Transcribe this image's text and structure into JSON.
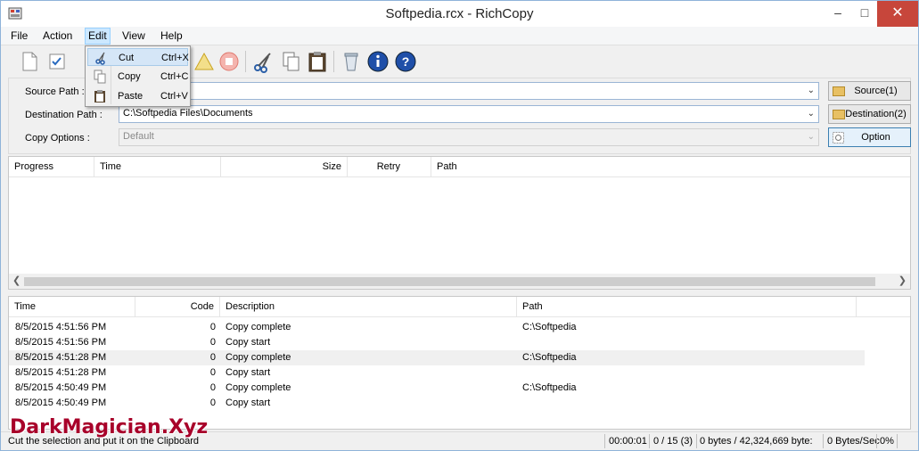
{
  "window": {
    "title": "Softpedia.rcx - RichCopy"
  },
  "menu": [
    "File",
    "Action",
    "Edit",
    "View",
    "Help"
  ],
  "paths": {
    "source_label": "Source Path :",
    "source_value": "",
    "dest_label": "Destination Path :",
    "dest_value": "C:\\Softpedia Files\\Documents",
    "options_label": "Copy Options :",
    "options_value": "Default",
    "source_button": "Source(1)",
    "dest_button": "Destination(2)",
    "option_button": "Option"
  },
  "progress_headers": [
    "Progress",
    "Time",
    "Size",
    "Retry",
    "Path"
  ],
  "log_headers": [
    "Time",
    "Code",
    "Description",
    "Path"
  ],
  "log_rows": [
    {
      "time": "8/5/2015 4:51:56 PM",
      "code": "0",
      "desc": "Copy complete",
      "path": "C:\\Softpedia"
    },
    {
      "time": "8/5/2015 4:51:56 PM",
      "code": "0",
      "desc": "Copy start",
      "path": ""
    },
    {
      "time": "8/5/2015 4:51:28 PM",
      "code": "0",
      "desc": "Copy complete",
      "path": "C:\\Softpedia"
    },
    {
      "time": "8/5/2015 4:51:28 PM",
      "code": "0",
      "desc": "Copy start",
      "path": ""
    },
    {
      "time": "8/5/2015 4:50:49 PM",
      "code": "0",
      "desc": "Copy complete",
      "path": "C:\\Softpedia"
    },
    {
      "time": "8/5/2015 4:50:49 PM",
      "code": "0",
      "desc": "Copy start",
      "path": ""
    }
  ],
  "edit_menu": [
    {
      "label": "Cut",
      "shortcut": "Ctrl+X"
    },
    {
      "label": "Copy",
      "shortcut": "Ctrl+C"
    },
    {
      "label": "Paste",
      "shortcut": "Ctrl+V"
    }
  ],
  "status": {
    "message": "Cut the selection and put it on the Clipboard",
    "elapsed": "00:00:01",
    "files": "0 / 15 (3)",
    "bytes": "0 bytes / 42,324,669 byte:",
    "rate": "0 Bytes/Sec",
    "percent": "0%"
  },
  "watermark": "DarkMagician.Xyz"
}
